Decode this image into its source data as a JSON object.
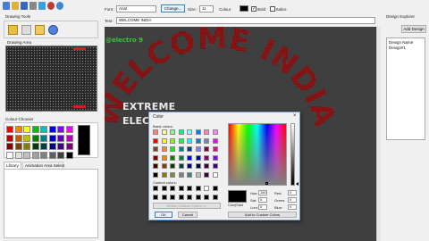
{
  "toolbar": {
    "icons": [
      {
        "name": "new-file-icon",
        "color": "#4a7bd0"
      },
      {
        "name": "open-folder-icon",
        "color": "#e0b03a"
      },
      {
        "name": "save-icon",
        "color": "#3a66c4"
      },
      {
        "name": "cut-icon",
        "color": "#666666"
      },
      {
        "name": "delete-icon",
        "color": "#3aa0e0"
      },
      {
        "name": "export-icon",
        "color": "#c03a3a"
      },
      {
        "name": "help-icon",
        "color": "#3a8ad0"
      }
    ],
    "font_label": "Font :",
    "font_value": "Arial",
    "change_button": "Change...",
    "size_label": "Size :",
    "size_value": "11",
    "colour_label": "Colour",
    "colour_value": "#000000",
    "bold_label": "Bold",
    "italics_label": "Italics",
    "text_label": "Text :",
    "text_value": "WELCOME INDIA"
  },
  "drawing_tools": {
    "title": "Drawing Tools"
  },
  "drawing_area": {
    "title": "Drawing Area"
  },
  "colour_chooser": {
    "title": "Colour Chooser",
    "swatches": [
      "#ff0000",
      "#ff8000",
      "#ffff00",
      "#00c000",
      "#00c0c0",
      "#0000ff",
      "#8000ff",
      "#ff00ff",
      "#c00000",
      "#c06000",
      "#c0c000",
      "#008000",
      "#008080",
      "#0000c0",
      "#6000c0",
      "#c000c0",
      "#800000",
      "#804000",
      "#808000",
      "#004000",
      "#004040",
      "#000080",
      "#400080",
      "#800080",
      "#ffffff",
      "#e0e0e0",
      "#c0c0c0",
      "#a0a0a0",
      "#808080",
      "#606060",
      "#404040",
      "#000000"
    ],
    "selected": "#000000"
  },
  "tabs": {
    "library": "Library",
    "animation": "Animation Area Select"
  },
  "canvas": {
    "watermark": "@electro 9",
    "arch_text": "WELCOME INDIA",
    "extreme": "EXTREME",
    "elect": "ELECT"
  },
  "color_dialog": {
    "title": "Color",
    "basic_colors_label": "Basic colors:",
    "basic_colors": [
      "#ff8080",
      "#ffff80",
      "#80ff80",
      "#00ff80",
      "#80ffff",
      "#0080ff",
      "#ff80c0",
      "#ff80ff",
      "#ff0000",
      "#ffff00",
      "#80ff00",
      "#00ff40",
      "#00ffff",
      "#0080c0",
      "#8080c0",
      "#ff00ff",
      "#804040",
      "#ff8040",
      "#00ff00",
      "#008080",
      "#004080",
      "#8080ff",
      "#800040",
      "#ff0080",
      "#800000",
      "#ff8000",
      "#008000",
      "#008040",
      "#0000ff",
      "#0000a0",
      "#800080",
      "#8000ff",
      "#400000",
      "#804000",
      "#004000",
      "#004040",
      "#000080",
      "#000040",
      "#400040",
      "#400080",
      "#000000",
      "#808000",
      "#808040",
      "#808080",
      "#408080",
      "#c0c0c0",
      "#400040",
      "#ffffff"
    ],
    "custom_colors_label": "Custom colors:",
    "custom_colors": [
      "#000000",
      "#000000",
      "#000000",
      "#000000",
      "#000000",
      "#000000",
      "#ffffff",
      "#000000",
      "#000000",
      "#000000",
      "#000000",
      "#000000",
      "#000000",
      "#000000",
      "#000000",
      "#000000"
    ],
    "define_custom": "Define Custom Colors >>",
    "ok": "OK",
    "cancel": "Cancel",
    "color_solid_label": "Color|Solid",
    "hue_label": "Hue:",
    "hue_value": "160",
    "sat_label": "Sat:",
    "sat_value": "0",
    "lum_label": "Lum:",
    "lum_value": "0",
    "red_label": "Red:",
    "red_value": "0",
    "green_label": "Green:",
    "green_value": "0",
    "blue_label": "Blue:",
    "blue_value": "0",
    "add_custom": "Add to Custom Colors",
    "close_glyph": "×"
  },
  "design_explorer": {
    "title": "Design Explorer",
    "add_button": "Add Design",
    "items": [
      "Design Name",
      "Design#1"
    ]
  }
}
